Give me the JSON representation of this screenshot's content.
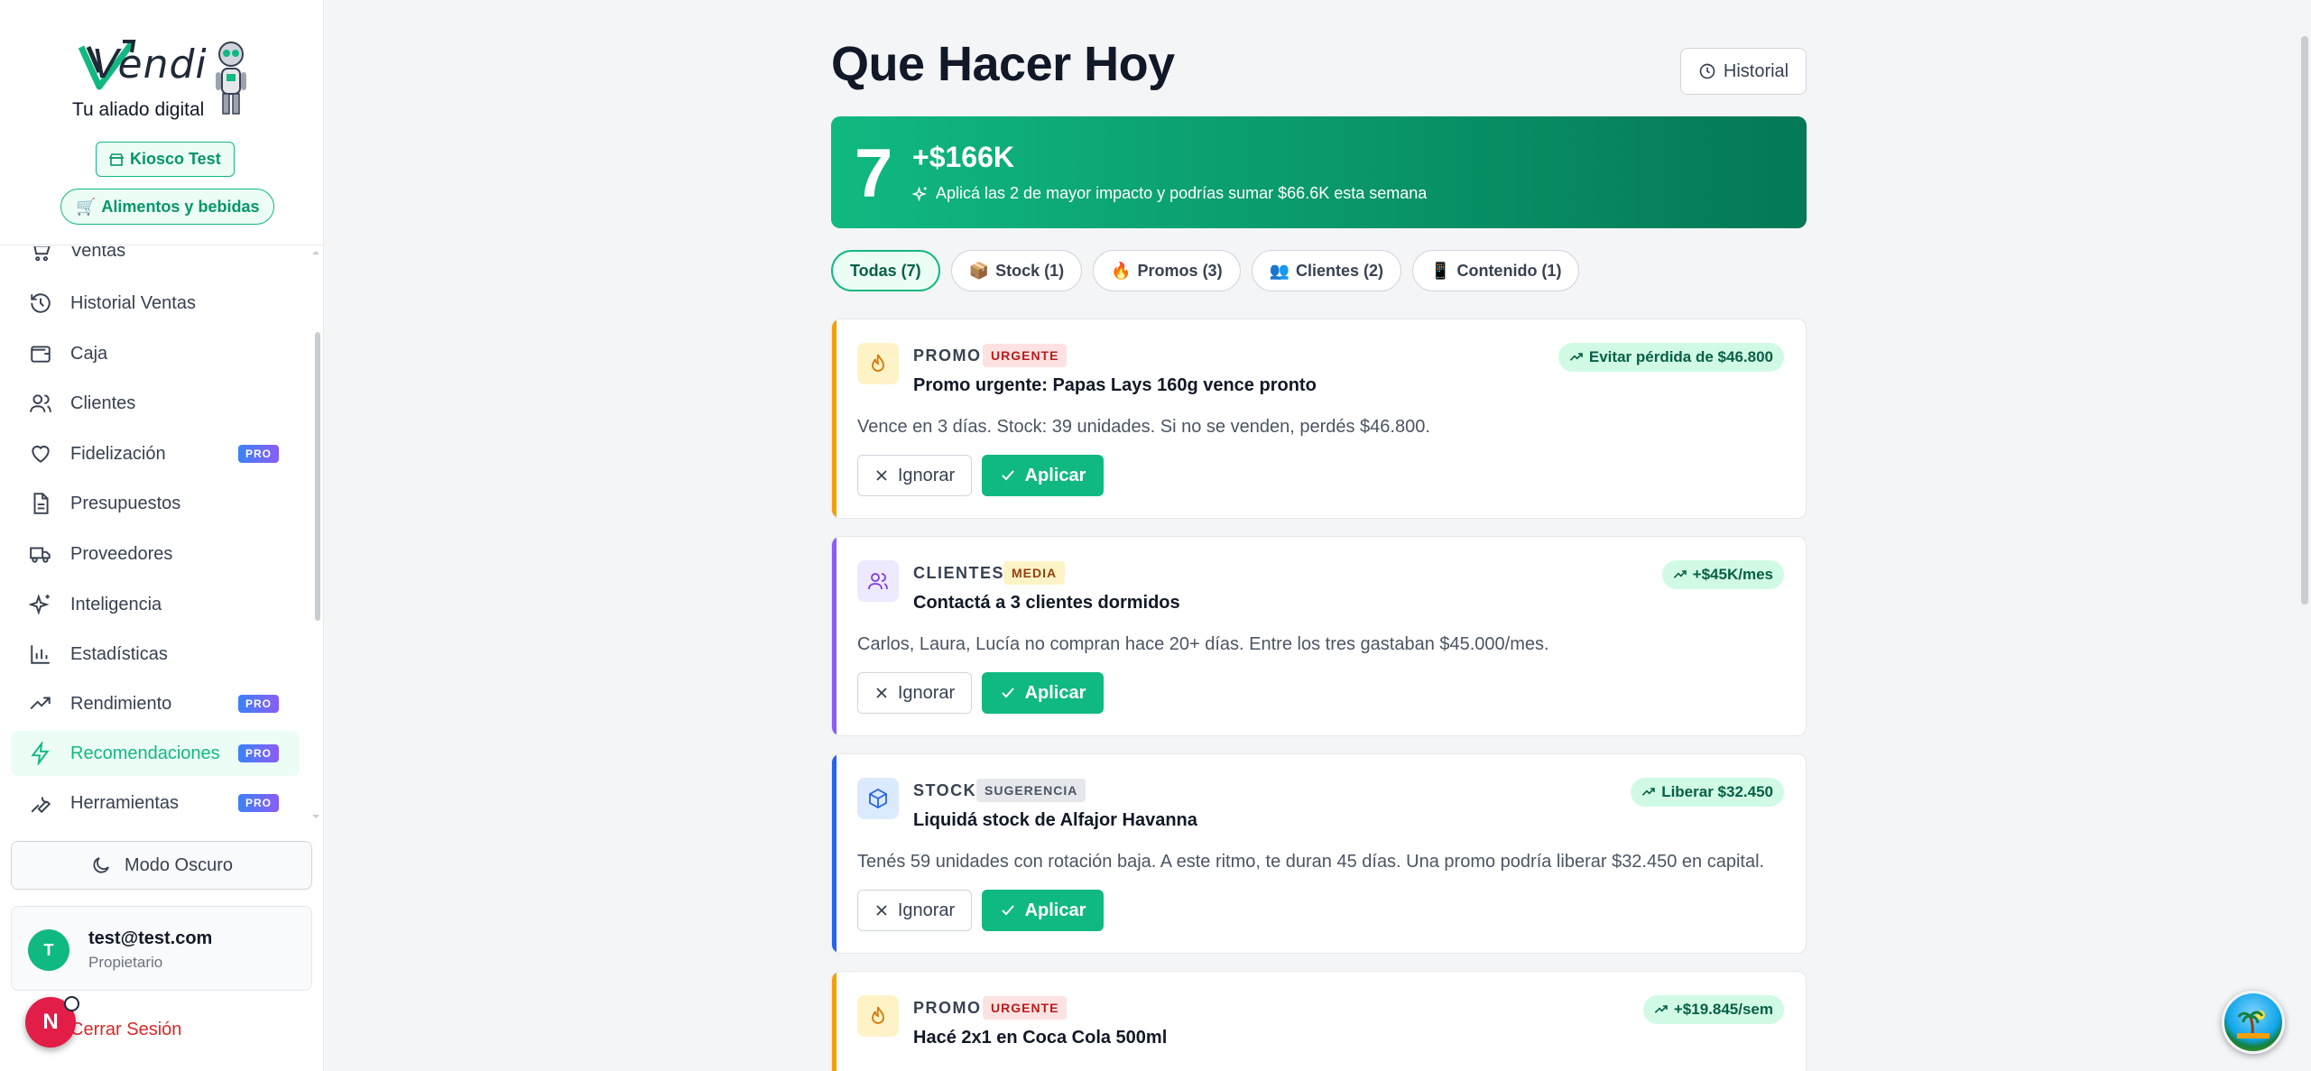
{
  "brand": {
    "name": "Vendi",
    "tagline": "Tu aliado digital",
    "store": "Kiosco Test",
    "category": "Alimentos y bebidas"
  },
  "nav": {
    "items": [
      {
        "label": "Ventas",
        "icon": "cart-icon"
      },
      {
        "label": "Historial Ventas",
        "icon": "history-icon"
      },
      {
        "label": "Caja",
        "icon": "wallet-icon"
      },
      {
        "label": "Clientes",
        "icon": "users-icon"
      },
      {
        "label": "Fidelización",
        "icon": "heart-icon",
        "badge": "PRO"
      },
      {
        "label": "Presupuestos",
        "icon": "document-icon"
      },
      {
        "label": "Proveedores",
        "icon": "truck-icon"
      },
      {
        "label": "Inteligencia",
        "icon": "sparkles-icon"
      },
      {
        "label": "Estadísticas",
        "icon": "bar-chart-icon"
      },
      {
        "label": "Rendimiento",
        "icon": "trending-up-icon",
        "badge": "PRO"
      },
      {
        "label": "Recomendaciones",
        "icon": "lightning-icon",
        "badge": "PRO",
        "active": true
      },
      {
        "label": "Herramientas",
        "icon": "wrench-icon",
        "badge": "PRO"
      }
    ]
  },
  "sidebar_footer": {
    "dark_mode": "Modo Oscuro",
    "user_initial": "T",
    "user_email": "test@test.com",
    "user_role": "Propietario",
    "logout": "Cerrar Sesión",
    "notif_initial": "N"
  },
  "header": {
    "title": "Que Hacer Hoy",
    "history_button": "Historial"
  },
  "summary": {
    "count": "7",
    "amount": "+$166K",
    "text": "Aplicá las 2 de mayor impacto y podrías sumar $66.6K esta semana"
  },
  "filters": [
    {
      "label": "Todas (7)",
      "emoji": "",
      "active": true
    },
    {
      "label": "Stock (1)",
      "emoji": "📦"
    },
    {
      "label": "Promos (3)",
      "emoji": "🔥"
    },
    {
      "label": "Clientes (2)",
      "emoji": "👥"
    },
    {
      "label": "Contenido (1)",
      "emoji": "📱"
    }
  ],
  "cards": [
    {
      "type": "PROMO",
      "tag": "URGENTE",
      "title": "Promo urgente: Papas Lays 160g vence pronto",
      "description": "Vence en 3 días. Stock: 39 unidades. Si no se venden, perdés $46.800.",
      "impact": "Evitar pérdida de $46.800",
      "icon": "flame-icon"
    },
    {
      "type": "CLIENTES",
      "tag": "MEDIA",
      "title": "Contactá a 3 clientes dormidos",
      "description": "Carlos, Laura, Lucía no compran hace 20+ días. Entre los tres gastaban $45.000/mes.",
      "impact": "+$45K/mes",
      "icon": "users-icon"
    },
    {
      "type": "STOCK",
      "tag": "SUGERENCIA",
      "title": "Liquidá stock de Alfajor Havanna",
      "description": "Tenés 59 unidades con rotación baja. A este ritmo, te duran 45 días. Una promo podría liberar $32.450 en capital.",
      "impact": "Liberar $32.450",
      "icon": "box-icon"
    },
    {
      "type": "PROMO",
      "tag": "URGENTE",
      "title": "Hacé 2x1 en Coca Cola 500ml",
      "description": "",
      "impact": "+$19.845/sem",
      "icon": "flame-icon"
    }
  ],
  "actions": {
    "ignore": "Ignorar",
    "apply": "Aplicar"
  },
  "colors": {
    "accent": "#10b981",
    "promo": "#f59e0b",
    "clientes": "#8b5cf6",
    "stock": "#2563eb"
  }
}
